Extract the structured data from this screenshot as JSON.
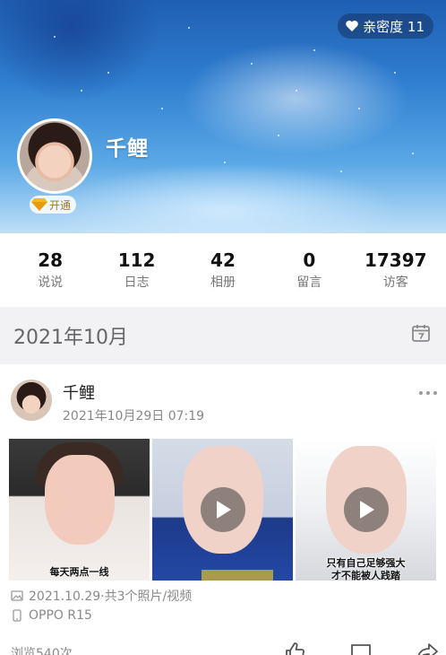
{
  "header": {
    "intimacy_label": "亲密度 11",
    "nickname": "千鲤",
    "vip_label": "开通"
  },
  "stats": [
    {
      "value": "28",
      "label": "说说"
    },
    {
      "value": "112",
      "label": "日志"
    },
    {
      "value": "42",
      "label": "相册"
    },
    {
      "value": "0",
      "label": "留言"
    },
    {
      "value": "17397",
      "label": "访客"
    }
  ],
  "timeline": {
    "month": "2021年10月"
  },
  "post": {
    "author": "千鲤",
    "time": "2021年10月29日 07:19",
    "photo_captions": [
      "每天两点一线",
      "只有自己足够强大",
      "才不能被人践踏"
    ],
    "photos_meta": "2021.10.29·共3个照片/视频",
    "device": "OPPO R15",
    "views": "浏览540次"
  },
  "colors": {
    "cover_top": "#1f5fb3",
    "text_primary": "#111111",
    "text_secondary": "#888888",
    "band_bg": "#f2f2f4"
  }
}
